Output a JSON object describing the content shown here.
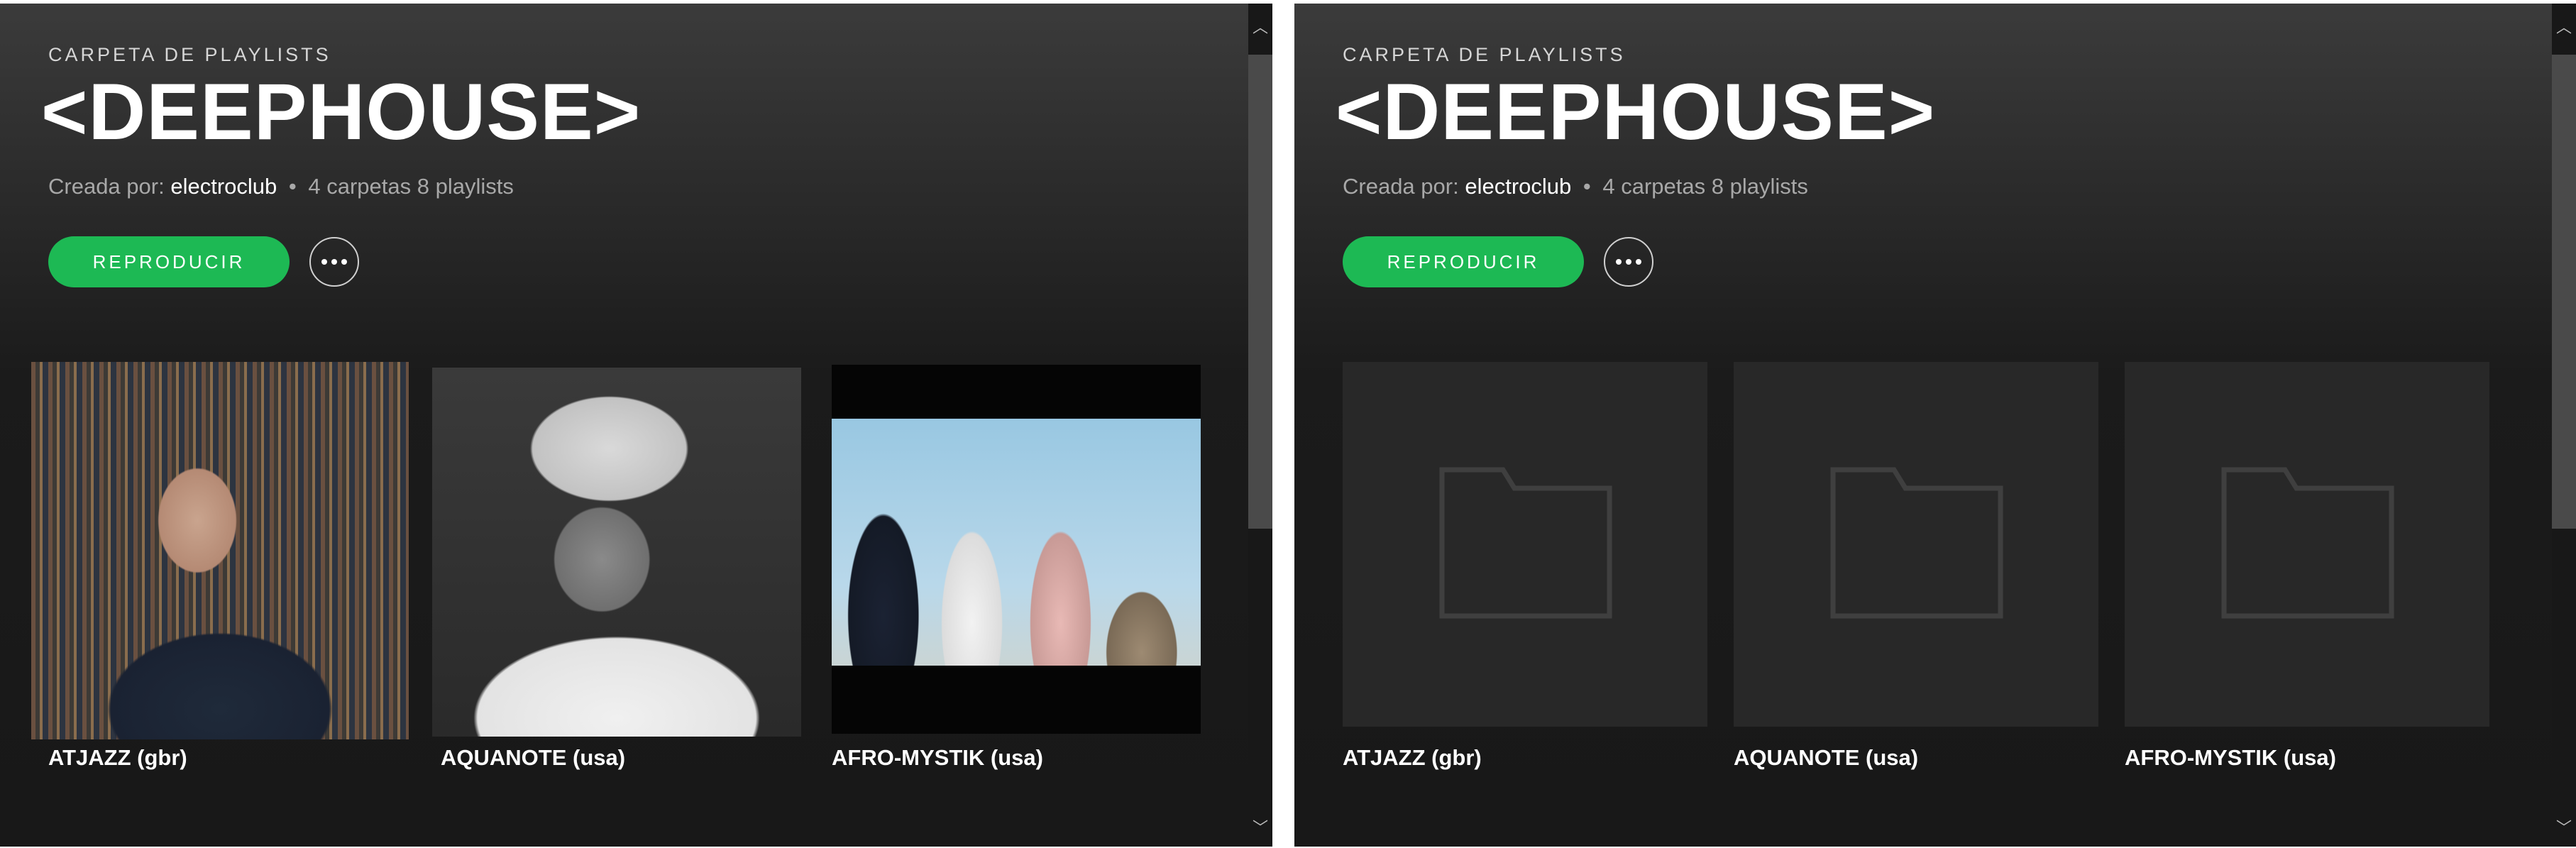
{
  "panels": [
    {
      "label": "CARPETA DE PLAYLISTS",
      "title": "<DEEPHOUSE>",
      "meta_prefix": "Creada por:",
      "owner": "electroclub",
      "separator": "•",
      "meta_counts": "4 carpetas 8 playlists",
      "play_label": "REPRODUCIR",
      "more_icon": "ellipsis-icon",
      "cards": [
        {
          "name": "ATJAZZ (gbr)",
          "art": "artist-photo"
        },
        {
          "name": "AQUANOTE (usa)",
          "art": "artist-photo"
        },
        {
          "name": "AFRO-MYSTIK (usa)",
          "art": "artist-photo"
        }
      ]
    },
    {
      "label": "CARPETA DE PLAYLISTS",
      "title": "<DEEPHOUSE>",
      "meta_prefix": "Creada por:",
      "owner": "electroclub",
      "separator": "•",
      "meta_counts": "4 carpetas 8 playlists",
      "play_label": "REPRODUCIR",
      "more_icon": "ellipsis-icon",
      "cards": [
        {
          "name": "ATJAZZ (gbr)",
          "art": "folder-icon"
        },
        {
          "name": "AQUANOTE (usa)",
          "art": "folder-icon"
        },
        {
          "name": "AFRO-MYSTIK (usa)",
          "art": "folder-icon"
        }
      ]
    }
  ],
  "scrollbar": {
    "up_glyph": "︿",
    "down_glyph": "﹀"
  },
  "colors": {
    "accent_green": "#1db954",
    "background_top": "#3b3b3b",
    "background_bottom": "#181818",
    "folder_tile": "#282828",
    "folder_stroke": "#3f3f3f",
    "text_primary": "#ffffff",
    "text_secondary": "#a8a8a8"
  }
}
